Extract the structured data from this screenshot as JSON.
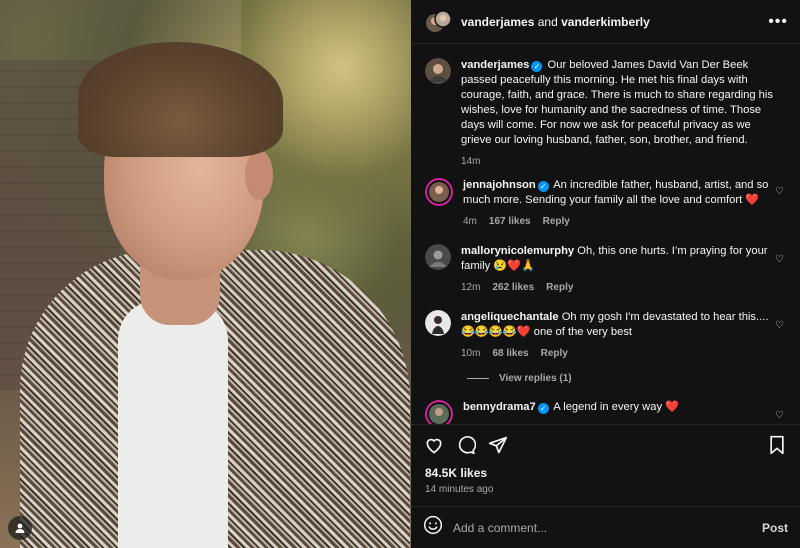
{
  "header": {
    "user1": "vanderjames",
    "and": " and ",
    "user2": "vanderkimberly",
    "more_label": "•••"
  },
  "caption": {
    "username": "vanderjames",
    "text": "Our beloved James David Van Der Beek passed peacefully this morning. He met his final days with courage, faith, and grace. There is much to share regarding his wishes, love for humanity and the sacredness of time. Those days will come. For now we ask for peaceful privacy as we grieve our loving husband, father, son, brother, and friend.",
    "time": "14m"
  },
  "comments": [
    {
      "username": "jennajohnson",
      "verified": true,
      "text": "An incredible father, husband, artist, and so much more. Sending your family all the love and comfort ❤️",
      "time": "4m",
      "likes": "167 likes",
      "reply": "Reply"
    },
    {
      "username": "mallorynicolemurphy",
      "verified": false,
      "text": "Oh, this one hurts. I’m praying for your family 😢❤️🙏",
      "time": "12m",
      "likes": "262 likes",
      "reply": "Reply"
    },
    {
      "username": "angeliquechantale",
      "verified": false,
      "text": "Oh my gosh I'm devastated to hear this.... 😂😂😂😂❤️ one of the very best",
      "time": "10m",
      "likes": "68 likes",
      "reply": "Reply"
    },
    {
      "username": "bennydrama7",
      "verified": true,
      "text": "A legend in every way ❤️",
      "time": "",
      "likes": "",
      "reply": ""
    }
  ],
  "view_replies": "View replies (1)",
  "post_likes": "84.5K likes",
  "post_time": "14 minutes ago",
  "add_comment": {
    "placeholder": "Add a comment...",
    "post_label": "Post"
  },
  "colors": {
    "background": "#121212",
    "verified": "#0095f6",
    "muted": "#a8a8a8"
  }
}
